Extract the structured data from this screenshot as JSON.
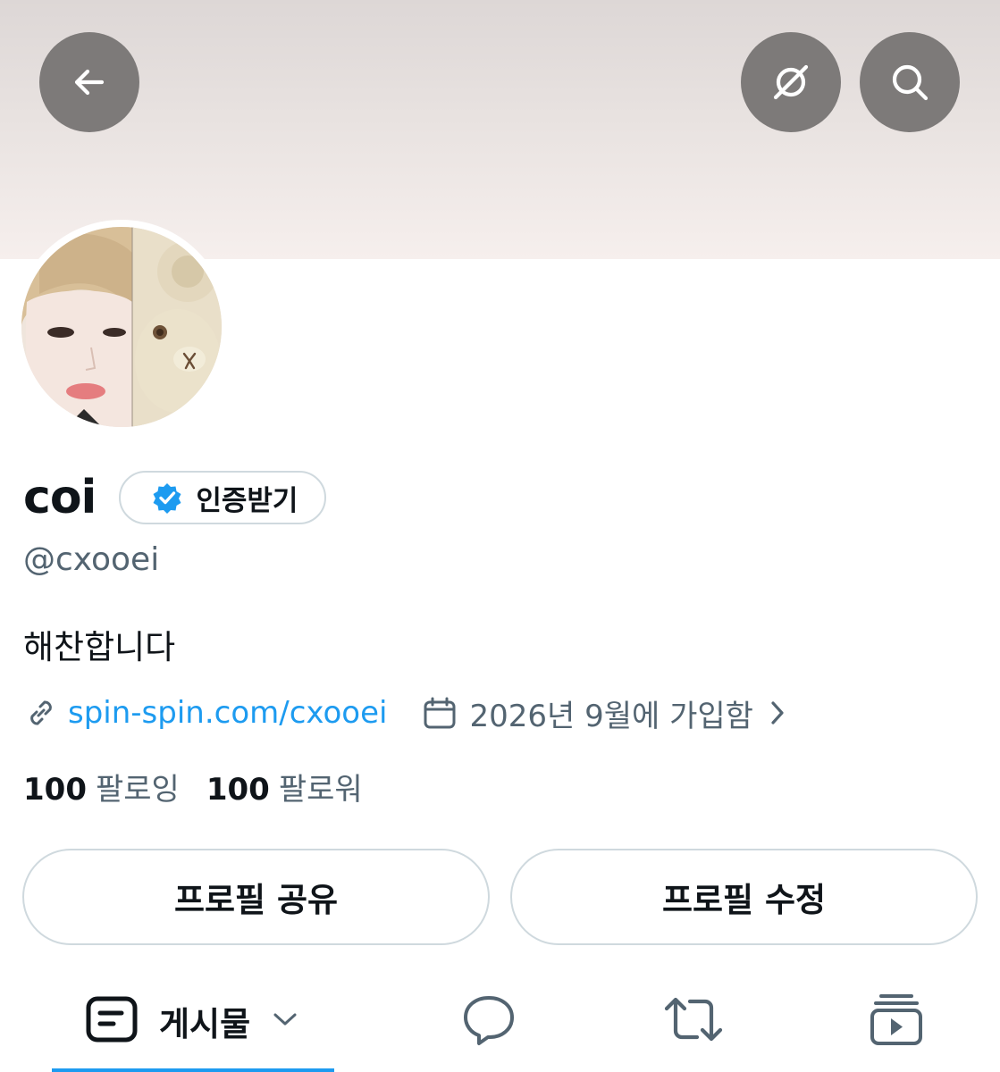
{
  "header": {
    "back_icon": "arrow-left-icon",
    "grok_icon": "grok-icon",
    "search_icon": "search-icon",
    "banner_color": "#e8e2e0"
  },
  "profile": {
    "display_name": "coi",
    "verify_button_label": "인증받기",
    "verify_badge_color": "#1d9bf0",
    "handle": "@cxooei",
    "bio": "해찬합니다",
    "website": "spin-spin.com/cxooei",
    "joined": "2026년 9월에 가입함",
    "following_count": "100",
    "following_label": "팔로잉",
    "followers_count": "100",
    "followers_label": "팔로워"
  },
  "actions": {
    "share_label": "프로필 공유",
    "edit_label": "프로필 수정"
  },
  "tabs": {
    "posts_label": "게시물",
    "posts_icon": "posts-icon",
    "replies_icon": "reply-icon",
    "reposts_icon": "repost-icon",
    "media_icon": "media-icon",
    "active_color": "#1d9bf0"
  }
}
